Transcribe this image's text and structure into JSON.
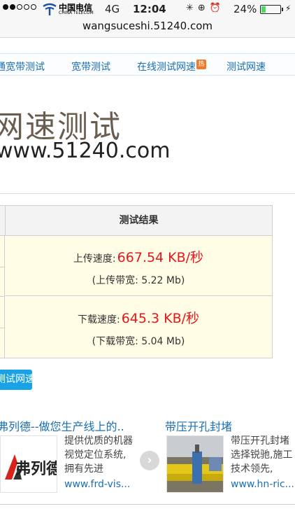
{
  "status_bar": {
    "carrier_name": "中国电信",
    "carrier_english": "CHINA TELECOM",
    "network": "4G",
    "time": "12:04",
    "battery_percent": "24%",
    "battery_level": 0.24,
    "icons": [
      "loading-icon",
      "orientation-lock-icon",
      "alarm-icon"
    ]
  },
  "browser": {
    "url": "wangsuceshi.51240.com"
  },
  "nav": {
    "items": [
      {
        "label": "通宽带测试"
      },
      {
        "label": "宽带测试"
      },
      {
        "label": "在线测试网速",
        "badge": "热"
      },
      {
        "label": "测试网速"
      }
    ]
  },
  "logo": {
    "title_cn": "网速测试",
    "site": "www.51240.com"
  },
  "result_table": {
    "header": "测试结果",
    "upload": {
      "label": "上传速度:",
      "speed": "667.54 KB/秒",
      "bandwidth": "(上传带宽: 5.22 Mb)"
    },
    "download": {
      "label": "下载速度:",
      "speed": "645.3 KB/秒",
      "bandwidth": "(下载带宽: 5.04 Mb)"
    }
  },
  "retest_button": {
    "label": "测试网速"
  },
  "ads": [
    {
      "title": "弗列德--做您生产线上的..",
      "image_text": "弗列德",
      "description": "提供优质的机器视觉定位系统, 拥有先进",
      "url": "www.frd-vis..."
    },
    {
      "title": "带压开孔封堵",
      "description": "带压开孔封堵选择锐驰,施工技术领先,",
      "url": "www.hn-ric..."
    }
  ],
  "colors": {
    "link": "#1a6fb5",
    "speed": "#e8161b",
    "button": "#19a3e6",
    "table_bg": "#fffde6"
  }
}
